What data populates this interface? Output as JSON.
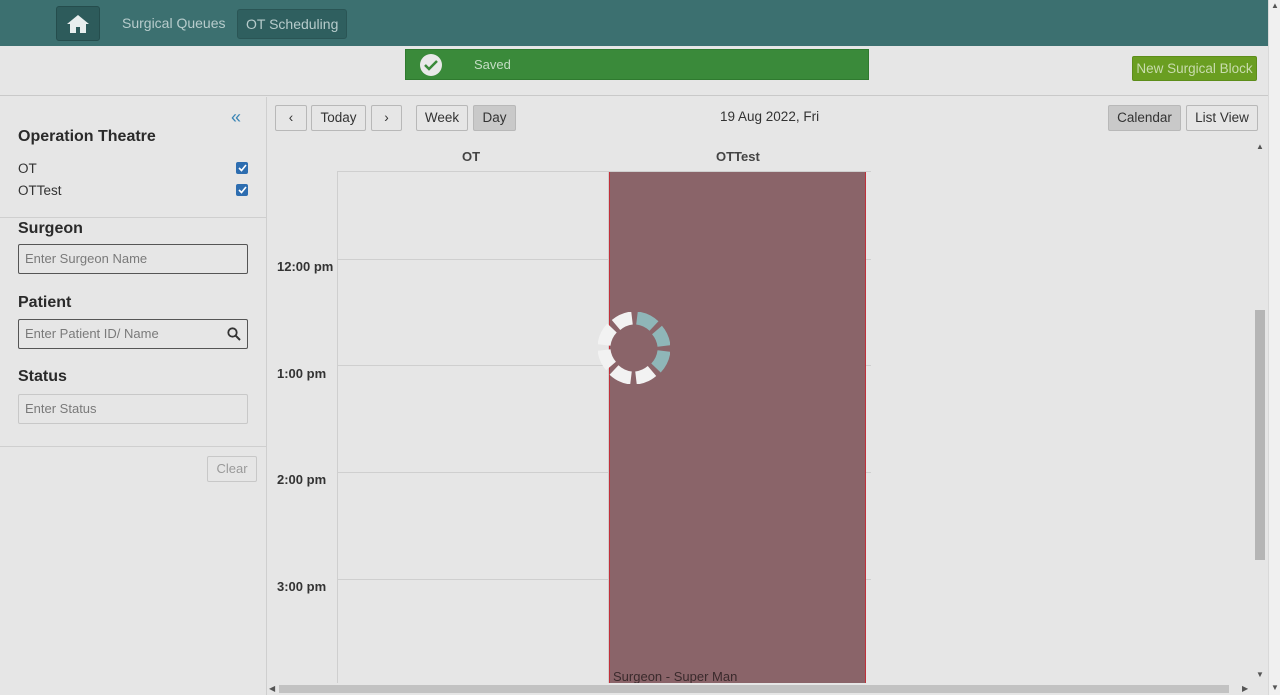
{
  "nav": {
    "home_icon": "home-icon",
    "links": [
      "Surgical Queues",
      "OT Scheduling"
    ],
    "active": "OT Scheduling"
  },
  "toast": {
    "message": "Saved",
    "icon": "check-circle-icon",
    "color": "#3a8a3a"
  },
  "header": {
    "new_block_label": "New Surgical Block",
    "new_block_color": "#6a9e21"
  },
  "sidebar": {
    "collapse_icon": "double-chevron-left-icon",
    "operation_theatre": {
      "title": "Operation Theatre",
      "items": [
        {
          "label": "OT",
          "checked": true
        },
        {
          "label": "OTTest",
          "checked": true
        }
      ]
    },
    "surgeon": {
      "title": "Surgeon",
      "placeholder": "Enter Surgeon Name"
    },
    "patient": {
      "title": "Patient",
      "placeholder": "Enter Patient ID/ Name"
    },
    "status": {
      "title": "Status",
      "placeholder": "Enter Status"
    },
    "clear_label": "Clear"
  },
  "calendar": {
    "prev_label": "‹",
    "next_label": "›",
    "today_label": "Today",
    "week_label": "Week",
    "day_label": "Day",
    "active_range": "Day",
    "date_title": "19 Aug 2022, Fri",
    "calendar_label": "Calendar",
    "list_view_label": "List View",
    "active_view": "Calendar",
    "columns": [
      "OT",
      "OTTest"
    ],
    "times": [
      "12:00 pm",
      "1:00 pm",
      "2:00 pm",
      "3:00 pm"
    ],
    "block": {
      "column": "OTTest",
      "label": "Surgeon - Super Man",
      "color": "#8a6469"
    }
  }
}
